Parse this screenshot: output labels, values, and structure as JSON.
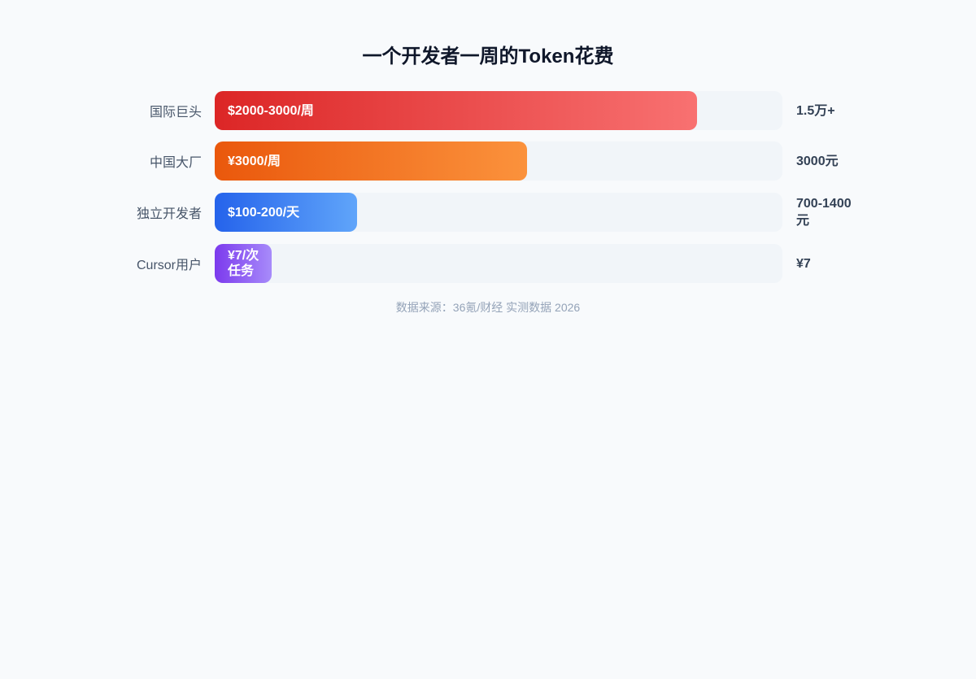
{
  "chart_data": {
    "type": "bar",
    "orientation": "horizontal",
    "title": "一个开发者一周的Token花费",
    "categories": [
      "国际巨头",
      "中国大厂",
      "独立开发者",
      "Cursor用户"
    ],
    "values": [
      85,
      55,
      25,
      10
    ],
    "bar_labels": [
      "$2000-3000/周",
      "¥3000/周",
      "$100-200/天",
      "¥7/次任务"
    ],
    "totals": [
      "1.5万+",
      "3000元",
      "700-1400元",
      "¥7"
    ],
    "xlim": [
      0,
      100
    ],
    "grid": false,
    "colors": [
      "#dc2626",
      "#ea580c",
      "#2563eb",
      "#7c3aed"
    ]
  },
  "source": "数据来源：36氪/财经 实测数据 2026"
}
